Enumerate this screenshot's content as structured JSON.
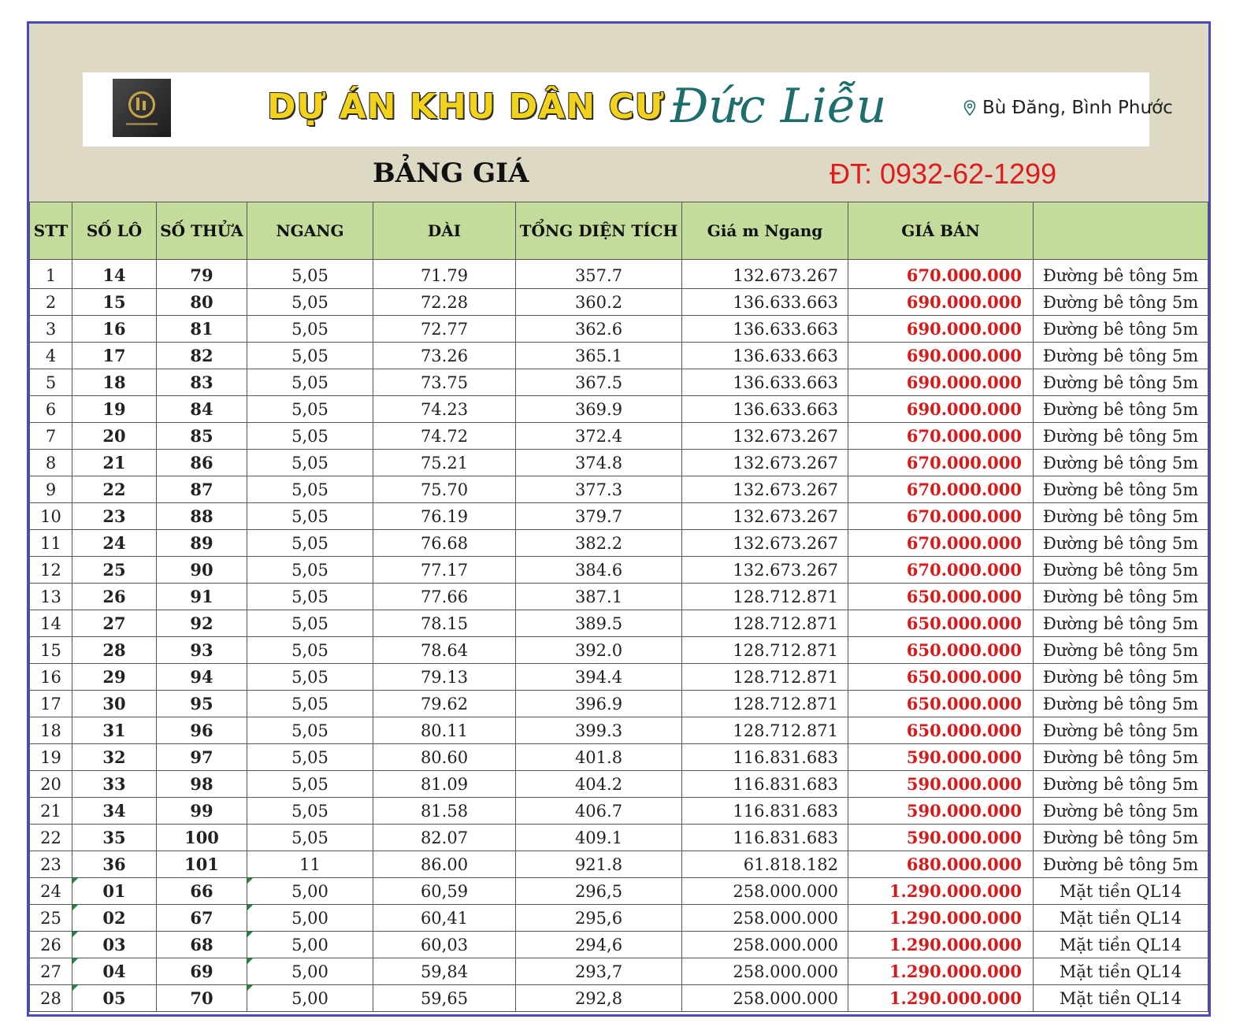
{
  "banner": {
    "title": "DỰ ÁN KHU DÂN CƯ",
    "script_name": "Đức Liễu",
    "location": "Bù Đăng, Bình Phước",
    "location_icon": "map-pin-icon",
    "logo_icon": "company-logo"
  },
  "page_title": "BẢNG GIÁ",
  "phone": "ĐT: 0932-62-1299",
  "colors": {
    "header_bg": "#ddd9c4",
    "table_header_bg": "#c4dc9b",
    "price_red": "#d61a1a",
    "frame_border": "#4a4ab8",
    "phone_red": "#e01b1b"
  },
  "table": {
    "headers": [
      "STT",
      "SỐ LÔ",
      "SỐ THỬA",
      "NGANG",
      "DÀI",
      "TỔNG DIỆN TÍCH",
      "Giá m Ngang",
      "GIÁ BÁN",
      ""
    ],
    "rows": [
      [
        "1",
        "14",
        "79",
        "5,05",
        "71.79",
        "357.7",
        "132.673.267",
        "670.000.000",
        "Đường bê tông 5m"
      ],
      [
        "2",
        "15",
        "80",
        "5,05",
        "72.28",
        "360.2",
        "136.633.663",
        "690.000.000",
        "Đường bê tông 5m"
      ],
      [
        "3",
        "16",
        "81",
        "5,05",
        "72.77",
        "362.6",
        "136.633.663",
        "690.000.000",
        "Đường bê tông 5m"
      ],
      [
        "4",
        "17",
        "82",
        "5,05",
        "73.26",
        "365.1",
        "136.633.663",
        "690.000.000",
        "Đường bê tông 5m"
      ],
      [
        "5",
        "18",
        "83",
        "5,05",
        "73.75",
        "367.5",
        "136.633.663",
        "690.000.000",
        "Đường bê tông 5m"
      ],
      [
        "6",
        "19",
        "84",
        "5,05",
        "74.23",
        "369.9",
        "136.633.663",
        "690.000.000",
        "Đường bê tông 5m"
      ],
      [
        "7",
        "20",
        "85",
        "5,05",
        "74.72",
        "372.4",
        "132.673.267",
        "670.000.000",
        "Đường bê tông 5m"
      ],
      [
        "8",
        "21",
        "86",
        "5,05",
        "75.21",
        "374.8",
        "132.673.267",
        "670.000.000",
        "Đường bê tông 5m"
      ],
      [
        "9",
        "22",
        "87",
        "5,05",
        "75.70",
        "377.3",
        "132.673.267",
        "670.000.000",
        "Đường bê tông 5m"
      ],
      [
        "10",
        "23",
        "88",
        "5,05",
        "76.19",
        "379.7",
        "132.673.267",
        "670.000.000",
        "Đường bê tông 5m"
      ],
      [
        "11",
        "24",
        "89",
        "5,05",
        "76.68",
        "382.2",
        "132.673.267",
        "670.000.000",
        "Đường bê tông 5m"
      ],
      [
        "12",
        "25",
        "90",
        "5,05",
        "77.17",
        "384.6",
        "132.673.267",
        "670.000.000",
        "Đường bê tông 5m"
      ],
      [
        "13",
        "26",
        "91",
        "5,05",
        "77.66",
        "387.1",
        "128.712.871",
        "650.000.000",
        "Đường bê tông 5m"
      ],
      [
        "14",
        "27",
        "92",
        "5,05",
        "78.15",
        "389.5",
        "128.712.871",
        "650.000.000",
        "Đường bê tông 5m"
      ],
      [
        "15",
        "28",
        "93",
        "5,05",
        "78.64",
        "392.0",
        "128.712.871",
        "650.000.000",
        "Đường bê tông 5m"
      ],
      [
        "16",
        "29",
        "94",
        "5,05",
        "79.13",
        "394.4",
        "128.712.871",
        "650.000.000",
        "Đường bê tông 5m"
      ],
      [
        "17",
        "30",
        "95",
        "5,05",
        "79.62",
        "396.9",
        "128.712.871",
        "650.000.000",
        "Đường bê tông 5m"
      ],
      [
        "18",
        "31",
        "96",
        "5,05",
        "80.11",
        "399.3",
        "128.712.871",
        "650.000.000",
        "Đường bê tông 5m"
      ],
      [
        "19",
        "32",
        "97",
        "5,05",
        "80.60",
        "401.8",
        "116.831.683",
        "590.000.000",
        "Đường bê tông 5m"
      ],
      [
        "20",
        "33",
        "98",
        "5,05",
        "81.09",
        "404.2",
        "116.831.683",
        "590.000.000",
        "Đường bê tông 5m"
      ],
      [
        "21",
        "34",
        "99",
        "5,05",
        "81.58",
        "406.7",
        "116.831.683",
        "590.000.000",
        "Đường bê tông 5m"
      ],
      [
        "22",
        "35",
        "100",
        "5,05",
        "82.07",
        "409.1",
        "116.831.683",
        "590.000.000",
        "Đường bê tông 5m"
      ],
      [
        "23",
        "36",
        "101",
        "11",
        "86.00",
        "921.8",
        "61.818.182",
        "680.000.000",
        "Đường bê tông 5m"
      ],
      [
        "24",
        "01",
        "66",
        "5,00",
        "60,59",
        "296,5",
        "258.000.000",
        "1.290.000.000",
        "Mặt tiền QL14"
      ],
      [
        "25",
        "02",
        "67",
        "5,00",
        "60,41",
        "295,6",
        "258.000.000",
        "1.290.000.000",
        "Mặt tiền QL14"
      ],
      [
        "26",
        "03",
        "68",
        "5,00",
        "60,03",
        "294,6",
        "258.000.000",
        "1.290.000.000",
        "Mặt tiền QL14"
      ],
      [
        "27",
        "04",
        "69",
        "5,00",
        "59,84",
        "293,7",
        "258.000.000",
        "1.290.000.000",
        "Mặt tiền QL14"
      ],
      [
        "28",
        "05",
        "70",
        "5,00",
        "59,65",
        "292,8",
        "258.000.000",
        "1.290.000.000",
        "Mặt tiền QL14"
      ]
    ]
  }
}
